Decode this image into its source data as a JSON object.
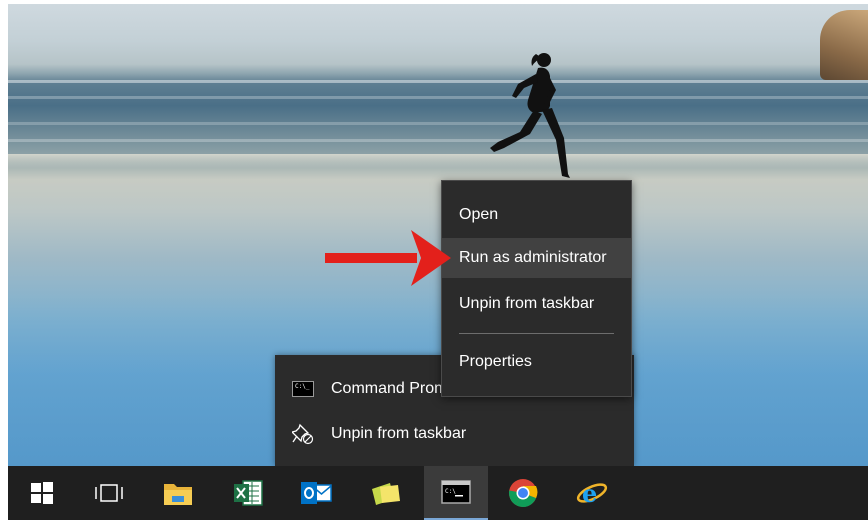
{
  "context_menu": {
    "items": [
      {
        "label": "Open"
      },
      {
        "label": "Run as administrator"
      },
      {
        "label": "Unpin from taskbar"
      },
      {
        "label": "Properties"
      }
    ],
    "highlighted": "Run as administrator"
  },
  "jump_list": {
    "items": [
      {
        "label": "Command Prompt",
        "icon": "command-prompt-icon"
      },
      {
        "label": "Unpin from taskbar",
        "icon": "unpin-icon"
      }
    ]
  },
  "taskbar": {
    "icons": [
      "windows-start-icon",
      "task-view-icon",
      "file-explorer-icon",
      "excel-icon",
      "outlook-icon",
      "sticky-notes-icon",
      "command-prompt-icon",
      "chrome-icon",
      "internet-explorer-icon"
    ],
    "active": "command-prompt-icon"
  },
  "colors": {
    "menu_bg": "#2b2b2b",
    "menu_hover": "#414141",
    "taskbar_bg": "#1f1f1f",
    "arrow": "#e3201b"
  }
}
